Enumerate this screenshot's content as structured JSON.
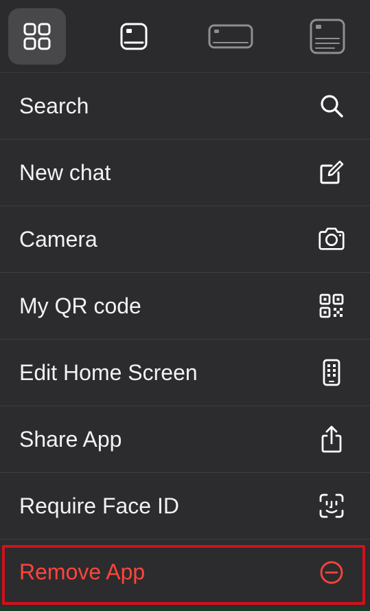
{
  "widget_bar": {
    "options": [
      {
        "icon": "app-grid-icon",
        "selected": true
      },
      {
        "icon": "small-widget-icon",
        "selected": false
      },
      {
        "icon": "medium-widget-icon",
        "selected": false
      },
      {
        "icon": "large-widget-icon",
        "selected": false
      }
    ]
  },
  "menu": {
    "items": [
      {
        "label": "Search",
        "icon": "search-icon"
      },
      {
        "label": "New chat",
        "icon": "compose-icon"
      },
      {
        "label": "Camera",
        "icon": "camera-icon"
      },
      {
        "label": "My QR code",
        "icon": "qr-code-icon"
      },
      {
        "label": "Edit Home Screen",
        "icon": "phone-apps-icon"
      },
      {
        "label": "Share App",
        "icon": "share-icon"
      },
      {
        "label": "Require Face ID",
        "icon": "face-id-icon"
      },
      {
        "label": "Remove App",
        "icon": "minus-circle-icon"
      }
    ]
  },
  "colors": {
    "menu_background": "#2c2c2e",
    "text": "#f2f2f7",
    "destructive": "#ff453a",
    "highlight_border": "#d0111b",
    "selected_widget": "#48484a"
  }
}
